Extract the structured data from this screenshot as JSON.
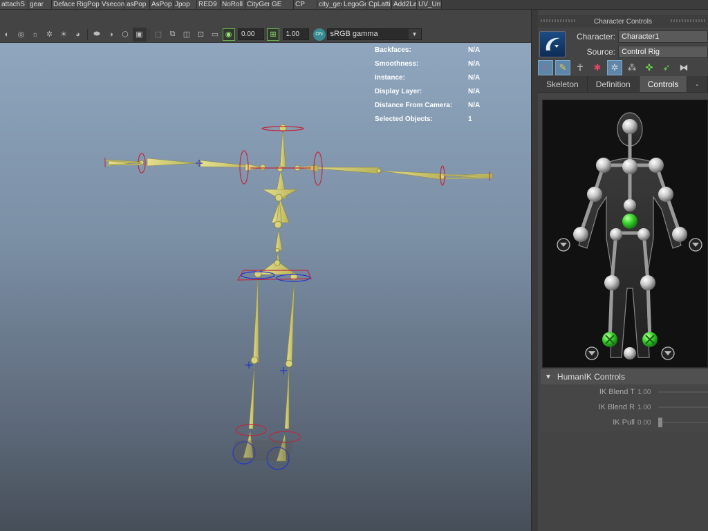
{
  "shelf": {
    "tabs": [
      "attachS",
      "gear",
      "Deface",
      "RigPop",
      "Vsecond",
      "asPop",
      "AsPop",
      "Jpop",
      "RED9",
      "NoRoll",
      "CityGen",
      "GE",
      "CP",
      "city_gen",
      "LegoGe",
      "CpLatti",
      "Add2La",
      "UV_Unf"
    ]
  },
  "toolbar": {
    "exposure": "0.00",
    "gamma": "1.00",
    "colorspace": "sRGB gamma",
    "icons": [
      "isolate-icon",
      "xray-icon",
      "light-icon",
      "shadow-icon",
      "ao-icon",
      "smooth-icon",
      "wireframe-icon",
      "grid-icon",
      "camera-icon",
      "film-gate-icon",
      "resolution-gate-icon",
      "field-chart-icon",
      "exposure-icon",
      "gamma-icon",
      "color-management-icon"
    ]
  },
  "hud": {
    "rows": [
      {
        "key": "Backfaces:",
        "val": "N/A"
      },
      {
        "key": "Smoothness:",
        "val": "N/A"
      },
      {
        "key": "Instance:",
        "val": "N/A"
      },
      {
        "key": "Display Layer:",
        "val": "N/A"
      },
      {
        "key": "Distance From Camera:",
        "val": "N/A"
      },
      {
        "key": "Selected Objects:",
        "val": "1"
      }
    ]
  },
  "character_controls": {
    "title": "Character Controls",
    "character_label": "Character:",
    "character_value": "Character1",
    "source_label": "Source:",
    "source_value": "Control Rig",
    "tabs": [
      {
        "label": "Skeleton",
        "active": false
      },
      {
        "label": "Definition",
        "active": false
      },
      {
        "label": "Controls",
        "active": true
      },
      {
        "label": "---",
        "active": false
      }
    ],
    "humanik": {
      "title": "HumanIK Controls",
      "rows": [
        {
          "label": "IK Blend T",
          "value": "1.00"
        },
        {
          "label": "IK Blend R",
          "value": "1.00"
        },
        {
          "label": "IK Pull",
          "value": "0.00"
        }
      ]
    }
  },
  "colors": {
    "viewport_top": "#8fa6be",
    "viewport_bottom": "#464e58",
    "joint_fill": "#d8d27a",
    "control_red": "#c0283c",
    "control_blue": "#2233cc",
    "effector_green": "#3ed83a"
  }
}
